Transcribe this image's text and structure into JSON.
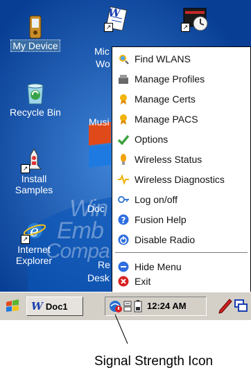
{
  "desktop": {
    "icons": [
      {
        "label_lines": [
          "My Device"
        ],
        "icon": "pda-device-icon"
      },
      {
        "label_lines": [
          "Recycle Bin"
        ],
        "icon": "recycle-bin-icon"
      },
      {
        "label_lines": [
          "Install",
          "Samples"
        ],
        "icon": "install-samples-icon"
      },
      {
        "label_lines": [
          "Internet",
          "Explorer"
        ],
        "icon": "internet-explorer-icon"
      }
    ],
    "partial_labels": [
      "Mic",
      "Wo",
      "Musi",
      "Doc",
      "Re",
      "Desk"
    ],
    "watermark": "Windows Embedded Compact",
    "top_icons": [
      "word-doc-icon",
      "calendar-clock-icon"
    ]
  },
  "menu": {
    "items": [
      {
        "label": "Find WLANS",
        "icon": "find-wlans-icon",
        "color": "#f2b40c"
      },
      {
        "label": "Manage Profiles",
        "icon": "manage-profiles-icon",
        "color": "#6a6a6a"
      },
      {
        "label": "Manage Certs",
        "icon": "manage-certs-icon",
        "color": "#f2b40c"
      },
      {
        "label": "Manage PACS",
        "icon": "manage-pacs-icon",
        "color": "#f2b40c"
      },
      {
        "label": "Options",
        "icon": "options-check-icon",
        "color": "#3fa23f"
      },
      {
        "label": "Wireless Status",
        "icon": "wireless-status-icon",
        "color": "#f2a20c"
      },
      {
        "label": "Wireless Diagnostics",
        "icon": "wireless-diagnostics-icon",
        "color": "#f0b000"
      },
      {
        "label": "Log on/off",
        "icon": "log-on-off-icon",
        "color": "#3a7ad8"
      },
      {
        "label": "Fusion Help",
        "icon": "help-icon",
        "color": "#2f6ee0"
      },
      {
        "label": "Disable Radio",
        "icon": "disable-radio-icon",
        "color": "#2f6ee0"
      }
    ],
    "footer_items": [
      {
        "label": "Hide Menu",
        "icon": "hide-menu-icon",
        "color": "#2f6ee0"
      },
      {
        "label": "Exit",
        "icon": "exit-icon",
        "color": "#d82020"
      }
    ]
  },
  "taskbar": {
    "start_icon": "windows-start-icon",
    "task_label": "Doc1",
    "clock": "12:24 AM",
    "tray_icons": [
      "signal-strength-icon",
      "network-status-icon",
      "battery-icon"
    ],
    "quick_icons": [
      "pen-icon",
      "desktop-switch-icon"
    ]
  },
  "callout": {
    "label": "Signal Strength Icon"
  }
}
